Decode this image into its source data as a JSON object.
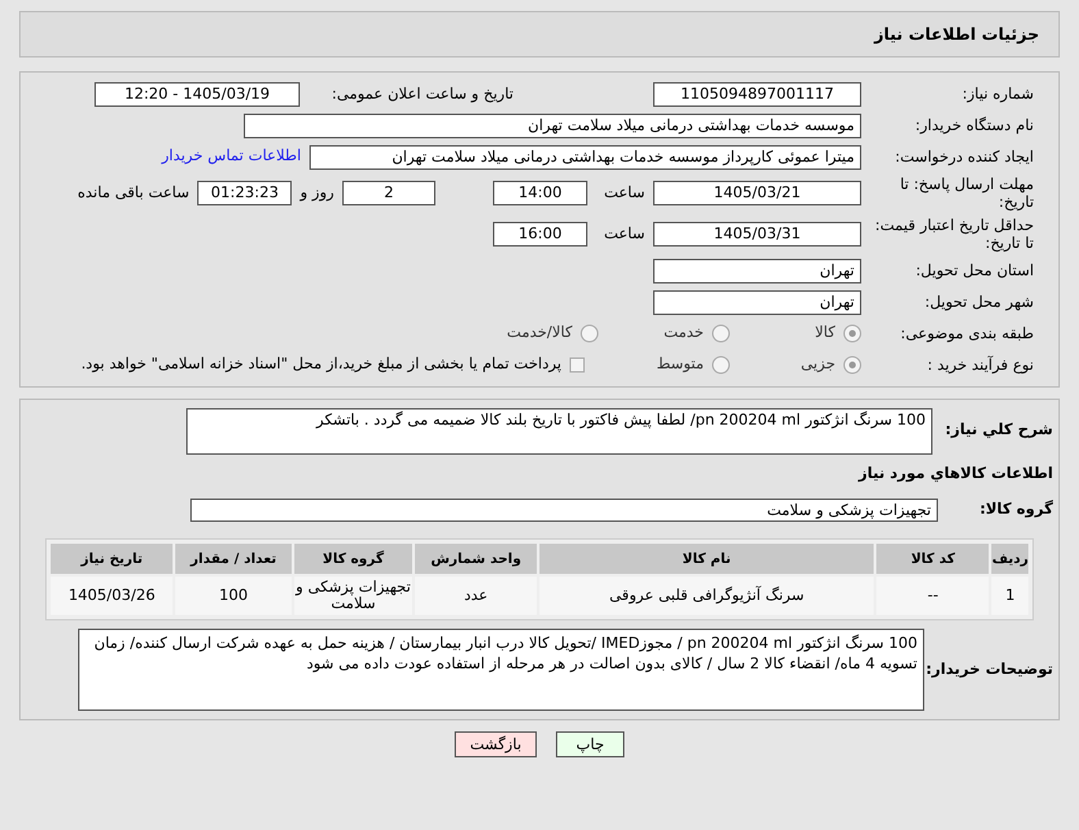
{
  "header": {
    "title": "جزئیات اطلاعات نیاز"
  },
  "need_number": {
    "label": "شماره نیاز:",
    "value": "1105094897001117"
  },
  "announce": {
    "label": "تاریخ و ساعت اعلان عمومی:",
    "value": "1405/03/19 - 12:20"
  },
  "buyer_org": {
    "label": "نام دستگاه خریدار:",
    "value": "موسسه خدمات بهداشتی درمانی میلاد سلامت تهران"
  },
  "requester": {
    "label": "ایجاد کننده درخواست:",
    "value": "میترا عموئی کارپرداز موسسه خدمات بهداشتی درمانی میلاد سلامت تهران",
    "link": "اطلاعات تماس خریدار"
  },
  "deadline": {
    "label": "مهلت ارسال پاسخ: تا تاریخ:",
    "date": "1405/03/21",
    "time_label": "ساعت",
    "time": "14:00",
    "days": "2",
    "days_label": "روز و",
    "remaining": "01:23:23",
    "remaining_label": "ساعت باقی مانده"
  },
  "price_validity": {
    "label": "حداقل تاریخ اعتبار قیمت: تا تاریخ:",
    "date": "1405/03/31",
    "time_label": "ساعت",
    "time": "16:00"
  },
  "province": {
    "label": "استان محل تحویل:",
    "value": "تهران"
  },
  "city": {
    "label": "شهر محل تحویل:",
    "value": "تهران"
  },
  "category": {
    "label": "طبقه بندی موضوعی:",
    "options": [
      {
        "label": "کالا",
        "selected": true
      },
      {
        "label": "خدمت",
        "selected": false
      },
      {
        "label": "کالا/خدمت",
        "selected": false
      }
    ]
  },
  "purchase_type": {
    "label": "نوع فرآیند خرید :",
    "options": [
      {
        "label": "جزیی",
        "selected": true
      },
      {
        "label": "متوسط",
        "selected": false
      }
    ],
    "treasury": {
      "label": "پرداخت تمام یا بخشی از مبلغ خرید،از محل \"اسناد خزانه اسلامی\" خواهد بود.",
      "checked": false
    }
  },
  "summary": {
    "label": "شرح كلي نياز:",
    "value": "100 سرنگ انژکتور pn 200204 ml/ لطفا پیش فاکتور با تاریخ بلند کالا ضمیمه می گردد . باتشکر"
  },
  "goods_heading": "اطلاعات كالاهاي مورد نياز",
  "goods_group": {
    "label": "گروه کالا:",
    "value": "تجهیزات پزشکی و سلامت"
  },
  "table": {
    "columns": [
      "ردیف",
      "کد کالا",
      "نام کالا",
      "واحد شمارش",
      "گروه کالا",
      "تعداد / مقدار",
      "تاریخ نیاز"
    ],
    "rows": [
      [
        "1",
        "--",
        "سرنگ آنژیوگرافی قلبی عروقی",
        "عدد",
        "تجهیزات پزشکی و سلامت",
        "100",
        "1405/03/26"
      ]
    ]
  },
  "buyer_notes": {
    "label": "توضیحات خریدار:",
    "value": "100 سرنگ انژکتور pn 200204 ml / مجوزIMED /تحویل کالا درب انبار بیمارستان / هزینه حمل به عهده شرکت ارسال کننده/ زمان تسویه 4 ماه/ انقضاء کالا 2 سال / کالای بدون اصالت در هر مرحله از استفاده عودت داده می شود"
  },
  "buttons": [
    {
      "label": "چاپ",
      "kind": "print"
    },
    {
      "label": "بازگشت",
      "kind": "back"
    }
  ]
}
